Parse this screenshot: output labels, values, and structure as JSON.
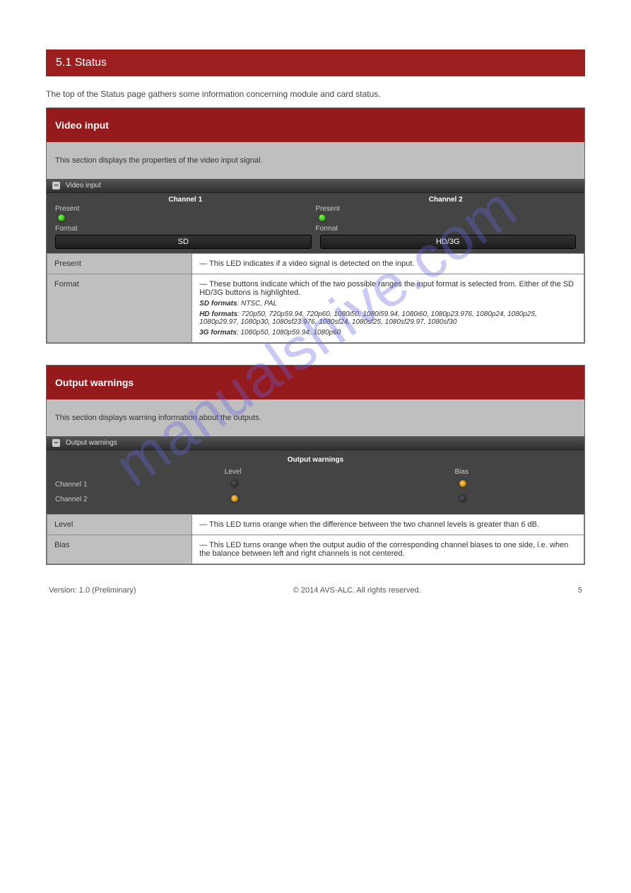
{
  "page": {
    "titlebar": "5.1 Status",
    "intro": "The top of the Status page gathers some information concerning module and card status.",
    "watermark": "manualshive.com"
  },
  "video": {
    "section_title": "Video input",
    "section_desc": "This section displays the properties of the video input signal.",
    "ui_label": "Video input",
    "ch1_label": "Channel 1",
    "ch2_label": "Channel 2",
    "present_label": "Present",
    "format_label": "Format",
    "fmt_sd": "SD",
    "fmt_hd": "HD/3G",
    "rows": [
      {
        "key": "Present",
        "val": "— This LED indicates if a video signal is detected on the input."
      },
      {
        "key": "Format",
        "val": "— These buttons indicate which of the two possible ranges the input format is selected from. Either of the SD HD/3G buttons is highlighted.",
        "sub_key": "SD formats",
        "sub_val": "NTSC, PAL",
        "sub_key2": "HD formats",
        "sub_val2": "720p50, 720p59.94, 720p60, 1080i50, 1080i59.94, 1080i60, 1080p23.976, 1080p24, 1080p25, 1080p29.97, 1080p30, 1080sf23.976, 1080sf24, 1080sf25, 1080sf29.97, 1080sf30",
        "sub_key3": "3G formats",
        "sub_val3": "1080p50, 1080p59.94, 1080p60"
      }
    ]
  },
  "output": {
    "section_title": "Output warnings",
    "section_desc": "This section displays warning information about the outputs.",
    "ui_label": "Output warnings",
    "ui_center": "Output warnings",
    "level_label": "Level",
    "bias_label": "Bias",
    "ch1": "Channel 1",
    "ch2": "Channel 2",
    "rows": [
      {
        "key": "Level",
        "val": "— This LED turns orange when the difference between the two channel levels is greater than 6 dB."
      },
      {
        "key": "Bias",
        "val": "— This LED turns orange when the output audio of the corresponding channel biases to one side, i.e. when the balance between left and right channels is not centered."
      }
    ]
  },
  "footer": {
    "left": "Version: 1.0 (Preliminary)",
    "center": "© 2014 AVS-ALC. All rights reserved.",
    "right": "5"
  }
}
